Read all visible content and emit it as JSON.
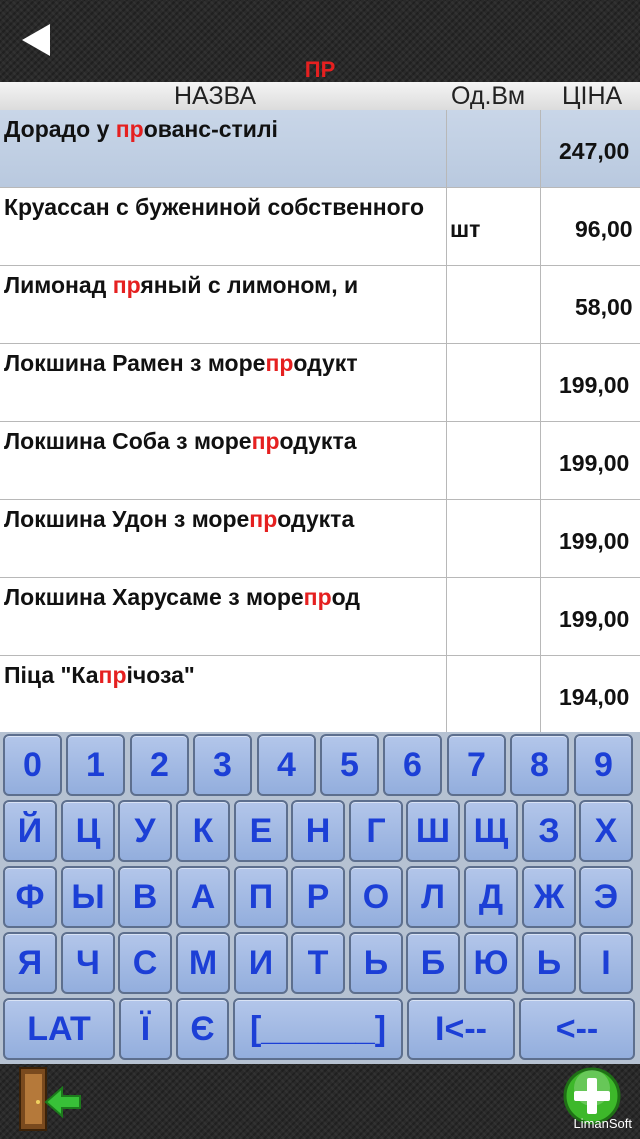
{
  "search": {
    "query": "ПР"
  },
  "header": {
    "name": "НАЗВА",
    "unit": "Од.Вм",
    "price": "ЦІНА"
  },
  "rows": [
    {
      "pre": "Дорадо у ",
      "hl": "пр",
      "post": "ованс-стилі",
      "unit": "",
      "price": "247,00",
      "selected": true
    },
    {
      "pre": "Круассан с бужениной собственного",
      "hl": "",
      "post": "",
      "unit": "шт",
      "price": "96,00",
      "selected": false
    },
    {
      "pre": "Лимонад ",
      "hl": "пр",
      "post": "яный с лимоном, и",
      "unit": "",
      "price": "58,00",
      "selected": false
    },
    {
      "pre": "Локшина Рамен з море",
      "hl": "пр",
      "post": "одукт",
      "unit": "",
      "price": "199,00",
      "selected": false
    },
    {
      "pre": "Локшина Соба з море",
      "hl": "пр",
      "post": "одукта",
      "unit": "",
      "price": "199,00",
      "selected": false
    },
    {
      "pre": "Локшина Удон з море",
      "hl": "пр",
      "post": "одукта",
      "unit": "",
      "price": "199,00",
      "selected": false
    },
    {
      "pre": "Локшина Харусаме з море",
      "hl": "пр",
      "post": "од",
      "unit": "",
      "price": "199,00",
      "selected": false
    },
    {
      "pre": "Піца \"Ка",
      "hl": "пр",
      "post": "ічоза\"",
      "unit": "",
      "price": "194,00",
      "selected": false
    }
  ],
  "keyboard": {
    "rows": [
      [
        "0",
        "1",
        "2",
        "3",
        "4",
        "5",
        "6",
        "7",
        "8",
        "9"
      ],
      [
        "Й",
        "Ц",
        "У",
        "К",
        "Е",
        "Н",
        "Г",
        "Ш",
        "Щ",
        "З",
        "Х"
      ],
      [
        "Ф",
        "Ы",
        "В",
        "А",
        "П",
        "Р",
        "О",
        "Л",
        "Д",
        "Ж",
        "Э"
      ],
      [
        "Я",
        "Ч",
        "С",
        "М",
        "И",
        "Т",
        "Ь",
        "Б",
        "Ю",
        "Ь",
        "І"
      ]
    ],
    "bottom": [
      {
        "label": "LAT",
        "name": "lat-key"
      },
      {
        "label": "Ї",
        "name": "key-yi"
      },
      {
        "label": "Є",
        "name": "key-ye"
      },
      {
        "label": "[______]",
        "name": "space-key"
      },
      {
        "label": "I<--",
        "name": "clear-key"
      },
      {
        "label": "<--",
        "name": "backspace-key"
      }
    ]
  },
  "brand": "LimanSoft",
  "icons": {
    "back": "back-arrow-icon",
    "exit": "exit-door-icon",
    "add": "add-plus-icon"
  },
  "colors": {
    "highlight": "#e52020",
    "key_text": "#1c3fd6",
    "selected_row": "#c4d2e6"
  }
}
